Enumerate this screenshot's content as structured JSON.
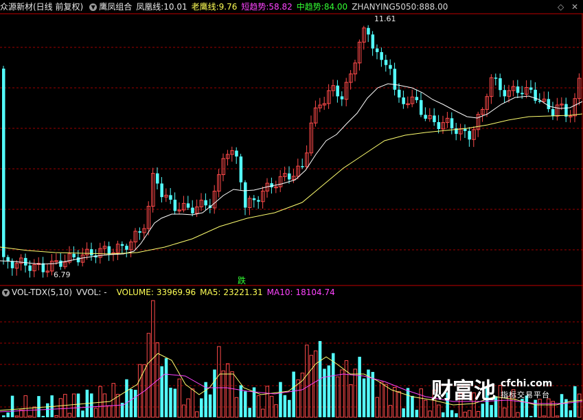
{
  "header": {
    "stock": "众源新材(日线 前复权)",
    "indicator": "鹰凤组合",
    "fenghuang_label": "凤凰线:",
    "fenghuang_value": "10.01",
    "laoying_label": "老鹰线:",
    "laoying_value": "9.76",
    "short_trend_label": "短趋势:",
    "short_trend_value": "58.82",
    "mid_trend_label": "中趋势:",
    "mid_trend_value": "84.00",
    "zhanying_label": "ZHANYING5050:",
    "zhanying_value": "888.00",
    "icons": [
      "settings-circle-icon",
      "diamond-icon",
      "close-icon"
    ]
  },
  "price_chart": {
    "high_label": "11.61",
    "low_label": "6.79",
    "die_marker": "跌"
  },
  "volume_header": {
    "name": "VOL-TDX(5,10)",
    "vvol": "VVOL: -",
    "volume_label": "VOLUME:",
    "volume_value": "33969.96",
    "ma5_label": "MA5:",
    "ma5_value": "23221.31",
    "ma10_label": "MA10:",
    "ma10_value": "18104.74",
    "icons": [
      "settings-circle-icon"
    ]
  },
  "watermark": {
    "brand": "财富池",
    "url": "cfchi.com",
    "slogan": "指标交易平台"
  },
  "colors": {
    "up": "#ff4a4a",
    "down": "#54ffff",
    "grid": "#a00000",
    "ma_white": "#ffffff",
    "ma_yellow": "#ffff70",
    "vol_ma5": "#ffff70",
    "vol_ma10": "#ff44ff"
  }
}
